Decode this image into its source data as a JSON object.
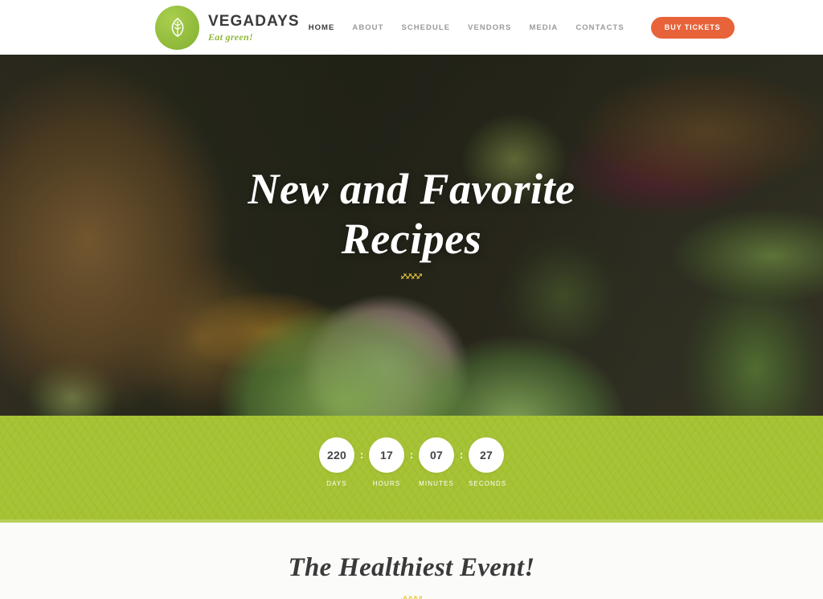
{
  "header": {
    "logo": {
      "icon": "leaf-icon",
      "name": "VEGADAYS",
      "tagline": "Eat green!",
      "circle_color": "#8fb939",
      "tagline_color": "#8fb939"
    },
    "nav": [
      {
        "label": "HOME",
        "active": true
      },
      {
        "label": "ABOUT",
        "active": false
      },
      {
        "label": "SCHEDULE",
        "active": false
      },
      {
        "label": "VENDORS",
        "active": false
      },
      {
        "label": "MEDIA",
        "active": false
      },
      {
        "label": "CONTACTS",
        "active": false
      }
    ],
    "cta": {
      "label": "BUY TICKETS",
      "color": "#e8633a"
    }
  },
  "hero": {
    "title_line1": "New and Favorite",
    "title_line2": "Recipes",
    "divider_icon": "zigzag-divider",
    "divider_color": "#e9c938"
  },
  "countdown": {
    "background_color": "#a5c233",
    "units": [
      {
        "value": "220",
        "label": "DAYS"
      },
      {
        "value": "17",
        "label": "HOURS"
      },
      {
        "value": "07",
        "label": "MINUTES"
      },
      {
        "value": "27",
        "label": "SECONDS"
      }
    ],
    "separator": ":"
  },
  "section": {
    "title": "The Healthiest Event!",
    "divider_icon": "zigzag-divider",
    "divider_color": "#e9c938"
  }
}
